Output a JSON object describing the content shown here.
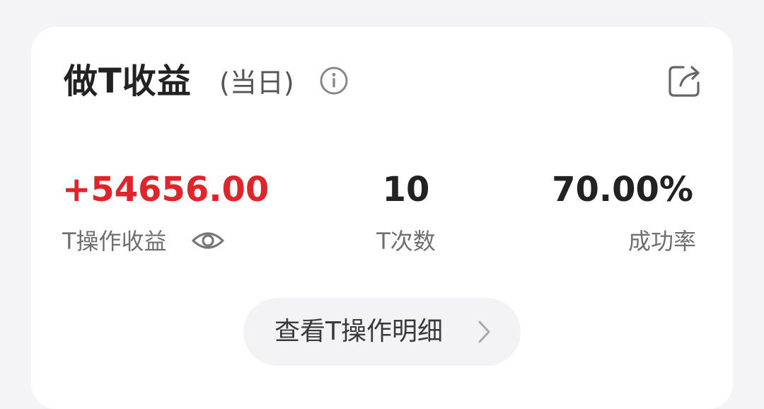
{
  "card": {
    "title": "做T收益",
    "subtitle": "(当日)",
    "info_icon": "info-icon",
    "share_icon": "share-icon"
  },
  "stats": {
    "profit": {
      "value": "+54656.00",
      "label": "T操作收益",
      "color": "#e2232a",
      "eye_icon": "eye-icon"
    },
    "count": {
      "value": "10",
      "label": "T次数"
    },
    "success_rate": {
      "value": "70.00%",
      "label": "成功率"
    }
  },
  "detail_button": {
    "label": "查看T操作明细",
    "icon": "chevron-right-icon"
  },
  "colors": {
    "positive": "#e2232a",
    "text_primary": "#222222",
    "text_secondary": "#6f6f6f",
    "button_bg": "#f3f3f5",
    "page_bg": "#f4f4f6"
  }
}
